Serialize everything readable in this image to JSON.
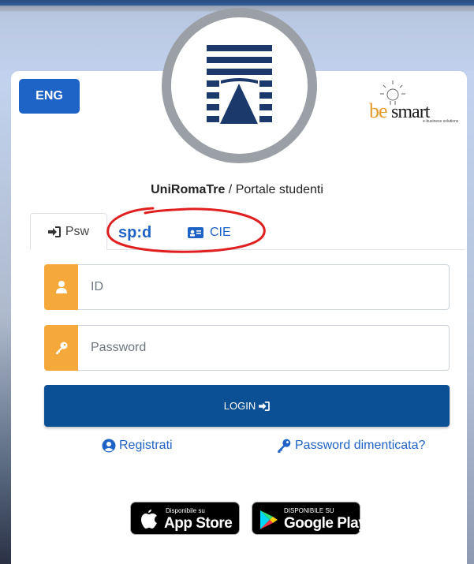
{
  "language_button": "ENG",
  "portal": {
    "university": "UniRomaTre",
    "separator": " / ",
    "name": "Portale studenti"
  },
  "partner_logo": {
    "brand_be": "be",
    "brand_smart": "smart",
    "tagline": "e-business solutions"
  },
  "tabs": {
    "psw_label": "Psw",
    "spid_label": "sp:d",
    "cie_label": "CIE"
  },
  "form": {
    "id_placeholder": "ID",
    "password_placeholder": "Password",
    "login_label": "LOGIN"
  },
  "links": {
    "register": "Registrati",
    "forgot_password": "Password dimenticata?"
  },
  "stores": {
    "apple_small": "Disponibile su",
    "apple_big": "App Store",
    "google_small": "DISPONIBILE SU",
    "google_big": "Google Play"
  },
  "colors": {
    "primary": "#1e63c6",
    "login": "#0b4f94",
    "addon": "#f5a93a",
    "annotation": "#e02020",
    "logo_navy": "#1b3a6b"
  }
}
